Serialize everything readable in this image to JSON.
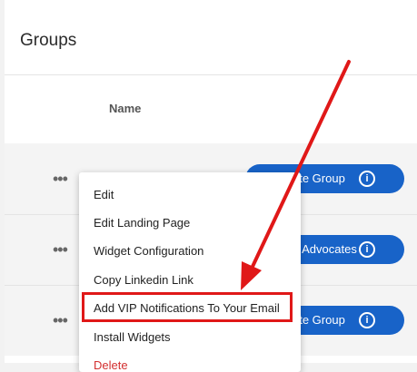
{
  "page": {
    "title": "Groups"
  },
  "table": {
    "column_header": "Name"
  },
  "rows": [
    {
      "more_label": "•••",
      "button_label": "ate Group"
    },
    {
      "more_label": "•••",
      "button_label": "g Advocates"
    },
    {
      "more_label": "•••",
      "button_label": "ate Group"
    }
  ],
  "menu": {
    "items": [
      "Edit",
      "Edit Landing Page",
      "Widget Configuration",
      "Copy Linkedin Link",
      "Add VIP Notifications To Your Email",
      "Install Widgets",
      "Delete"
    ],
    "highlighted_index": 4
  },
  "annotation": {
    "color": "#e01818"
  },
  "colors": {
    "button": "#1863c8",
    "highlight": "#e01818"
  }
}
